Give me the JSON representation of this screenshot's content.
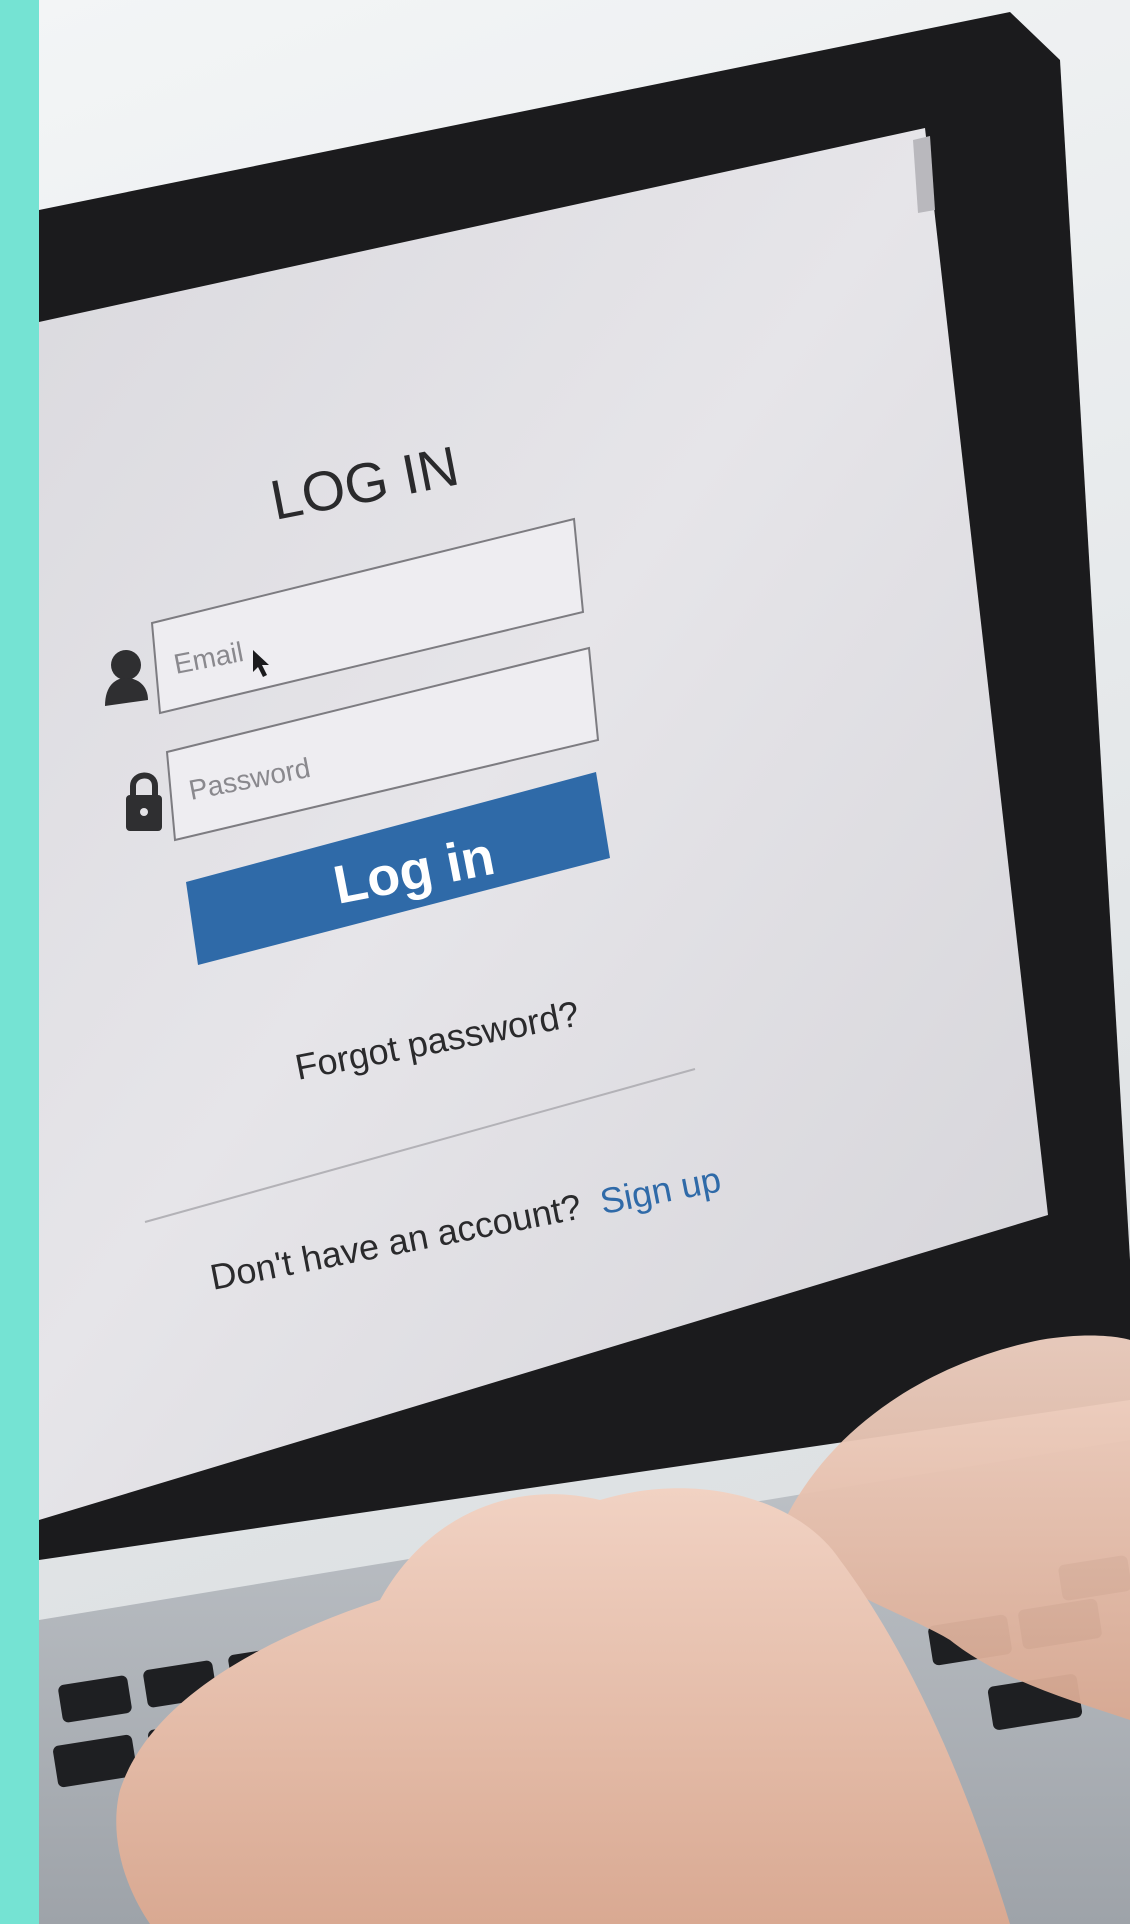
{
  "colors": {
    "accent_strip": "#75e3d3",
    "button": "#2f6aa8",
    "link": "#2f6aa8",
    "screen": "#e4e3e7",
    "bezel": "#1b1b1d"
  },
  "login": {
    "title": "LOG IN",
    "email_placeholder": "Email",
    "password_placeholder": "Password",
    "button_label": "Log in",
    "forgot_link": "Forgot password?",
    "no_account_text": "Don't have an account?",
    "signup_link": "Sign up"
  },
  "icons": {
    "user": "user-icon",
    "lock": "lock-icon",
    "cursor": "mouse-cursor-icon"
  }
}
